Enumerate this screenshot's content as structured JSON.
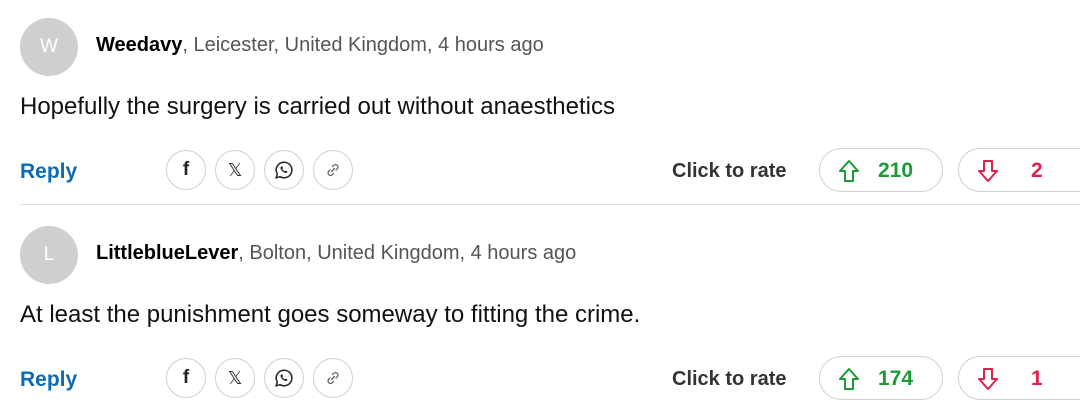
{
  "comments": [
    {
      "avatar_initial": "W",
      "username": "Weedavy",
      "location": ", Leicester, United Kingdom, 4 hours ago",
      "text": "Hopefully the surgery is carried out without anaesthetics",
      "reply_label": "Reply",
      "share_icons": [
        "facebook-icon",
        "x-icon",
        "whatsapp-icon",
        "link-icon"
      ],
      "rate_label": "Click to rate",
      "upvotes": "210",
      "downvotes": "2"
    },
    {
      "avatar_initial": "L",
      "username": "LittleblueLever",
      "location": ", Bolton, United Kingdom, 4 hours ago",
      "text": "At least the punishment goes someway to fitting the crime.",
      "reply_label": "Reply",
      "share_icons": [
        "facebook-icon",
        "x-icon",
        "whatsapp-icon",
        "link-icon"
      ],
      "rate_label": "Click to rate",
      "upvotes": "174",
      "downvotes": "1"
    }
  ],
  "colors": {
    "reply": "#0b6bb5",
    "upvote": "#1a9b36",
    "downvote": "#e0224a",
    "avatar_bg": "#cfcfcf"
  }
}
